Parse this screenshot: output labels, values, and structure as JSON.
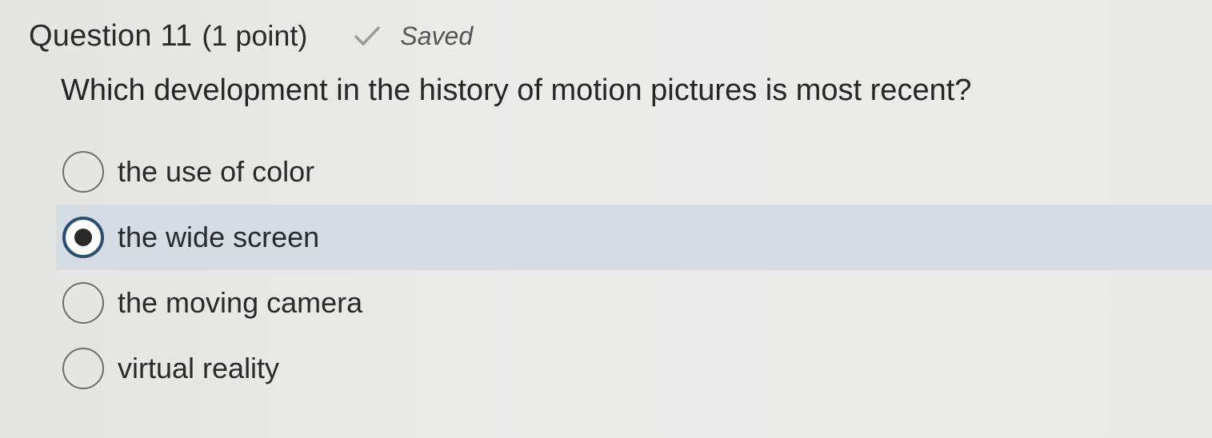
{
  "question": {
    "title": "Question 11",
    "points": "(1 point)",
    "status": "Saved",
    "status_icon": "checkmark-icon",
    "text": "Which development in the history of motion pictures is most recent?"
  },
  "options": [
    {
      "label": "the use of color",
      "selected": false
    },
    {
      "label": "the wide screen",
      "selected": true
    },
    {
      "label": "the moving camera",
      "selected": false
    },
    {
      "label": "virtual reality",
      "selected": false
    }
  ],
  "colors": {
    "selected_highlight": "#d6dde2",
    "selected_ring": "#2b4f6e"
  }
}
